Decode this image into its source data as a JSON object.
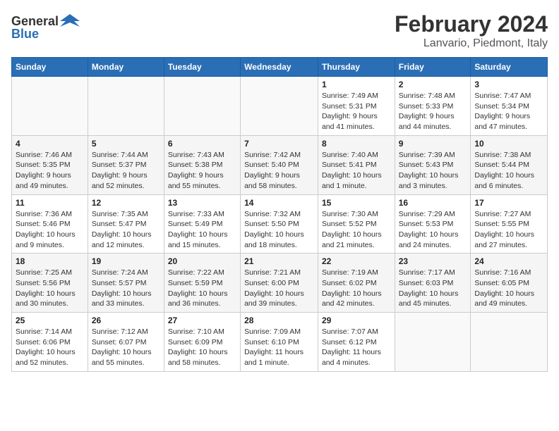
{
  "logo": {
    "text_general": "General",
    "text_blue": "Blue"
  },
  "title": "February 2024",
  "subtitle": "Lanvario, Piedmont, Italy",
  "days_of_week": [
    "Sunday",
    "Monday",
    "Tuesday",
    "Wednesday",
    "Thursday",
    "Friday",
    "Saturday"
  ],
  "weeks": [
    [
      {
        "day": "",
        "info": ""
      },
      {
        "day": "",
        "info": ""
      },
      {
        "day": "",
        "info": ""
      },
      {
        "day": "",
        "info": ""
      },
      {
        "day": "1",
        "info": "Sunrise: 7:49 AM\nSunset: 5:31 PM\nDaylight: 9 hours and 41 minutes."
      },
      {
        "day": "2",
        "info": "Sunrise: 7:48 AM\nSunset: 5:33 PM\nDaylight: 9 hours and 44 minutes."
      },
      {
        "day": "3",
        "info": "Sunrise: 7:47 AM\nSunset: 5:34 PM\nDaylight: 9 hours and 47 minutes."
      }
    ],
    [
      {
        "day": "4",
        "info": "Sunrise: 7:46 AM\nSunset: 5:35 PM\nDaylight: 9 hours and 49 minutes."
      },
      {
        "day": "5",
        "info": "Sunrise: 7:44 AM\nSunset: 5:37 PM\nDaylight: 9 hours and 52 minutes."
      },
      {
        "day": "6",
        "info": "Sunrise: 7:43 AM\nSunset: 5:38 PM\nDaylight: 9 hours and 55 minutes."
      },
      {
        "day": "7",
        "info": "Sunrise: 7:42 AM\nSunset: 5:40 PM\nDaylight: 9 hours and 58 minutes."
      },
      {
        "day": "8",
        "info": "Sunrise: 7:40 AM\nSunset: 5:41 PM\nDaylight: 10 hours and 1 minute."
      },
      {
        "day": "9",
        "info": "Sunrise: 7:39 AM\nSunset: 5:43 PM\nDaylight: 10 hours and 3 minutes."
      },
      {
        "day": "10",
        "info": "Sunrise: 7:38 AM\nSunset: 5:44 PM\nDaylight: 10 hours and 6 minutes."
      }
    ],
    [
      {
        "day": "11",
        "info": "Sunrise: 7:36 AM\nSunset: 5:46 PM\nDaylight: 10 hours and 9 minutes."
      },
      {
        "day": "12",
        "info": "Sunrise: 7:35 AM\nSunset: 5:47 PM\nDaylight: 10 hours and 12 minutes."
      },
      {
        "day": "13",
        "info": "Sunrise: 7:33 AM\nSunset: 5:49 PM\nDaylight: 10 hours and 15 minutes."
      },
      {
        "day": "14",
        "info": "Sunrise: 7:32 AM\nSunset: 5:50 PM\nDaylight: 10 hours and 18 minutes."
      },
      {
        "day": "15",
        "info": "Sunrise: 7:30 AM\nSunset: 5:52 PM\nDaylight: 10 hours and 21 minutes."
      },
      {
        "day": "16",
        "info": "Sunrise: 7:29 AM\nSunset: 5:53 PM\nDaylight: 10 hours and 24 minutes."
      },
      {
        "day": "17",
        "info": "Sunrise: 7:27 AM\nSunset: 5:55 PM\nDaylight: 10 hours and 27 minutes."
      }
    ],
    [
      {
        "day": "18",
        "info": "Sunrise: 7:25 AM\nSunset: 5:56 PM\nDaylight: 10 hours and 30 minutes."
      },
      {
        "day": "19",
        "info": "Sunrise: 7:24 AM\nSunset: 5:57 PM\nDaylight: 10 hours and 33 minutes."
      },
      {
        "day": "20",
        "info": "Sunrise: 7:22 AM\nSunset: 5:59 PM\nDaylight: 10 hours and 36 minutes."
      },
      {
        "day": "21",
        "info": "Sunrise: 7:21 AM\nSunset: 6:00 PM\nDaylight: 10 hours and 39 minutes."
      },
      {
        "day": "22",
        "info": "Sunrise: 7:19 AM\nSunset: 6:02 PM\nDaylight: 10 hours and 42 minutes."
      },
      {
        "day": "23",
        "info": "Sunrise: 7:17 AM\nSunset: 6:03 PM\nDaylight: 10 hours and 45 minutes."
      },
      {
        "day": "24",
        "info": "Sunrise: 7:16 AM\nSunset: 6:05 PM\nDaylight: 10 hours and 49 minutes."
      }
    ],
    [
      {
        "day": "25",
        "info": "Sunrise: 7:14 AM\nSunset: 6:06 PM\nDaylight: 10 hours and 52 minutes."
      },
      {
        "day": "26",
        "info": "Sunrise: 7:12 AM\nSunset: 6:07 PM\nDaylight: 10 hours and 55 minutes."
      },
      {
        "day": "27",
        "info": "Sunrise: 7:10 AM\nSunset: 6:09 PM\nDaylight: 10 hours and 58 minutes."
      },
      {
        "day": "28",
        "info": "Sunrise: 7:09 AM\nSunset: 6:10 PM\nDaylight: 11 hours and 1 minute."
      },
      {
        "day": "29",
        "info": "Sunrise: 7:07 AM\nSunset: 6:12 PM\nDaylight: 11 hours and 4 minutes."
      },
      {
        "day": "",
        "info": ""
      },
      {
        "day": "",
        "info": ""
      }
    ]
  ]
}
